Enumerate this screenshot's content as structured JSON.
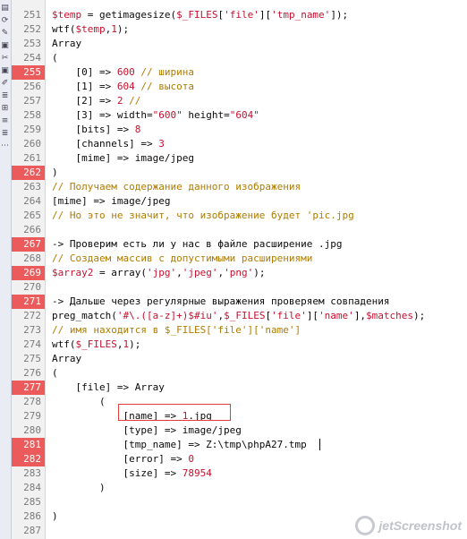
{
  "toolbar": {
    "icons": [
      "doc-icon",
      "refresh-icon",
      "note-icon",
      "bookmark-icon",
      "cut-icon",
      "bookmark2-icon",
      "edit-icon",
      "list-icon",
      "tree-icon",
      "format-icon",
      "list2-icon",
      "misc-icon"
    ]
  },
  "lines": [
    {
      "n": "251",
      "bp": false,
      "t": [
        [
          "var",
          "$temp"
        ],
        [
          "plain",
          " = getimagesize("
        ],
        [
          "var",
          "$_FILES"
        ],
        [
          "plain",
          "["
        ],
        [
          "str",
          "'file'"
        ],
        [
          "plain",
          "]["
        ],
        [
          "str",
          "'tmp_name'"
        ],
        [
          "plain",
          "]);"
        ]
      ]
    },
    {
      "n": "252",
      "bp": false,
      "t": [
        [
          "plain",
          "wtf("
        ],
        [
          "var",
          "$temp"
        ],
        [
          "plain",
          ","
        ],
        [
          "num",
          "1"
        ],
        [
          "plain",
          ");"
        ]
      ]
    },
    {
      "n": "253",
      "bp": false,
      "t": [
        [
          "plain",
          "Array"
        ]
      ]
    },
    {
      "n": "254",
      "bp": false,
      "t": [
        [
          "plain",
          "("
        ]
      ]
    },
    {
      "n": "255",
      "bp": true,
      "t": [
        [
          "plain",
          "    [0] => "
        ],
        [
          "num",
          "600"
        ],
        [
          "com",
          " // ширина"
        ]
      ]
    },
    {
      "n": "256",
      "bp": false,
      "t": [
        [
          "plain",
          "    [1] => "
        ],
        [
          "num",
          "604"
        ],
        [
          "com",
          " // высота"
        ]
      ]
    },
    {
      "n": "257",
      "bp": false,
      "t": [
        [
          "plain",
          "    [2] => "
        ],
        [
          "num",
          "2"
        ],
        [
          "com",
          " //"
        ]
      ]
    },
    {
      "n": "258",
      "bp": false,
      "t": [
        [
          "plain",
          "    [3] => width="
        ],
        [
          "str",
          "\"600\""
        ],
        [
          "plain",
          " height="
        ],
        [
          "str",
          "\"604\""
        ]
      ]
    },
    {
      "n": "259",
      "bp": false,
      "t": [
        [
          "plain",
          "    [bits] => "
        ],
        [
          "num",
          "8"
        ]
      ]
    },
    {
      "n": "260",
      "bp": false,
      "t": [
        [
          "plain",
          "    [channels] => "
        ],
        [
          "num",
          "3"
        ]
      ]
    },
    {
      "n": "261",
      "bp": false,
      "t": [
        [
          "plain",
          "    [mime] => image/jpeg"
        ]
      ]
    },
    {
      "n": "262",
      "bp": true,
      "t": [
        [
          "plain",
          ")"
        ]
      ]
    },
    {
      "n": "263",
      "bp": false,
      "t": [
        [
          "com",
          "// Получаем содержание данного изображения"
        ]
      ]
    },
    {
      "n": "264",
      "bp": false,
      "t": [
        [
          "plain",
          "[mime] => image/jpeg"
        ]
      ]
    },
    {
      "n": "265",
      "bp": false,
      "t": [
        [
          "com",
          "// Но это не значит, что изображение будет 'pic.jpg"
        ]
      ]
    },
    {
      "n": "266",
      "bp": false,
      "t": []
    },
    {
      "n": "267",
      "bp": true,
      "t": [
        [
          "plain",
          "-> Проверим есть ли у нас в файле расширение .jpg"
        ]
      ]
    },
    {
      "n": "268",
      "bp": false,
      "t": [
        [
          "com",
          "// Создаем массив с допустимыми расширениями"
        ]
      ]
    },
    {
      "n": "269",
      "bp": true,
      "t": [
        [
          "var",
          "$array2"
        ],
        [
          "plain",
          " = array("
        ],
        [
          "str",
          "'jpg'"
        ],
        [
          "plain",
          ","
        ],
        [
          "str",
          "'jpeg'"
        ],
        [
          "plain",
          ","
        ],
        [
          "str",
          "'png'"
        ],
        [
          "plain",
          ");"
        ]
      ]
    },
    {
      "n": "270",
      "bp": false,
      "t": []
    },
    {
      "n": "271",
      "bp": true,
      "t": [
        [
          "plain",
          "-> Дальше через регулярные выражения проверяем совпадения"
        ]
      ]
    },
    {
      "n": "272",
      "bp": false,
      "t": [
        [
          "plain",
          "preg_match("
        ],
        [
          "str",
          "'#\\.([a-z]+)$#iu'"
        ],
        [
          "plain",
          ","
        ],
        [
          "var",
          "$_FILES"
        ],
        [
          "plain",
          "["
        ],
        [
          "str",
          "'file'"
        ],
        [
          "plain",
          "]["
        ],
        [
          "str",
          "'name'"
        ],
        [
          "plain",
          "],"
        ],
        [
          "var",
          "$matches"
        ],
        [
          "plain",
          ");"
        ]
      ]
    },
    {
      "n": "273",
      "bp": false,
      "t": [
        [
          "com",
          "// имя находится в $_FILES['file']['name']"
        ]
      ]
    },
    {
      "n": "274",
      "bp": false,
      "t": [
        [
          "plain",
          "wtf("
        ],
        [
          "var",
          "$_FILES"
        ],
        [
          "plain",
          ","
        ],
        [
          "num",
          "1"
        ],
        [
          "plain",
          ");"
        ]
      ]
    },
    {
      "n": "275",
      "bp": false,
      "t": [
        [
          "plain",
          "Array"
        ]
      ]
    },
    {
      "n": "276",
      "bp": false,
      "t": [
        [
          "plain",
          "("
        ]
      ]
    },
    {
      "n": "277",
      "bp": true,
      "t": [
        [
          "plain",
          "    [file] => Array"
        ]
      ]
    },
    {
      "n": "278",
      "bp": false,
      "t": [
        [
          "plain",
          "        ("
        ]
      ]
    },
    {
      "n": "279",
      "bp": false,
      "t": [
        [
          "plain",
          "            [name] => "
        ],
        [
          "num",
          "1"
        ],
        [
          "plain",
          ".jpg"
        ]
      ]
    },
    {
      "n": "280",
      "bp": false,
      "t": [
        [
          "plain",
          "            [type] => image/jpeg"
        ]
      ]
    },
    {
      "n": "281",
      "bp": true,
      "t": [
        [
          "plain",
          "            [tmp_name] => Z:\\tmp\\phpA27.tmp"
        ]
      ]
    },
    {
      "n": "282",
      "bp": true,
      "t": [
        [
          "plain",
          "            [error] => "
        ],
        [
          "num",
          "0"
        ]
      ]
    },
    {
      "n": "283",
      "bp": false,
      "t": [
        [
          "plain",
          "            [size] => "
        ],
        [
          "num",
          "78954"
        ]
      ]
    },
    {
      "n": "284",
      "bp": false,
      "t": [
        [
          "plain",
          "        )"
        ]
      ]
    },
    {
      "n": "285",
      "bp": false,
      "t": []
    },
    {
      "n": "286",
      "bp": false,
      "t": [
        [
          "plain",
          ")"
        ]
      ]
    },
    {
      "n": "287",
      "bp": false,
      "t": []
    }
  ],
  "watermark": {
    "text": "jetScreenshot"
  }
}
